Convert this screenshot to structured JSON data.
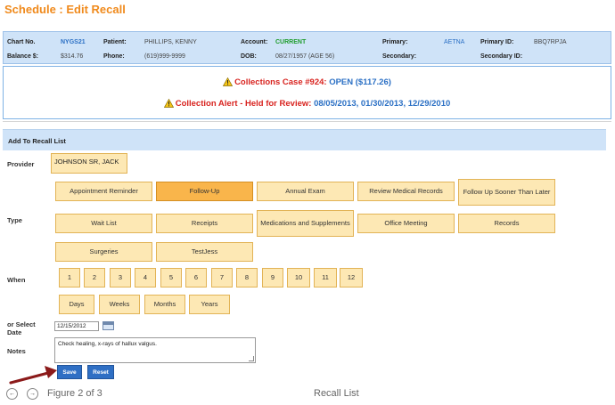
{
  "page_title": "Schedule : Edit Recall",
  "patient": {
    "chart_no_label": "Chart No.",
    "chart_no": "NYGS21",
    "patient_label": "Patient:",
    "patient_name": "PHILLIPS, KENNY",
    "account_label": "Account:",
    "account_status": "CURRENT",
    "primary_label": "Primary:",
    "primary_value": "AETNA",
    "primary_id_label": "Primary ID:",
    "primary_id": "BBQ7RPJA",
    "balance_label": "Balance $:",
    "balance": "$314.76",
    "phone_label": "Phone:",
    "phone": "(619)999-9999",
    "dob_label": "DOB:",
    "dob": "08/27/1957  (AGE 56)",
    "secondary_label": "Secondary:",
    "secondary_id_label": "Secondary ID:"
  },
  "alerts": {
    "case_prefix": "Collections Case #924:",
    "case_status": "OPEN ($117.26)",
    "alert_prefix": "Collection Alert - Held for Review:",
    "alert_dates": "08/05/2013, 01/30/2013, 12/29/2010"
  },
  "section_title": "Add To Recall List",
  "provider": {
    "label": "Provider",
    "value": "JOHNSON SR, JACK"
  },
  "type": {
    "label": "Type",
    "options": [
      "Appointment Reminder",
      "Follow-Up",
      "Annual Exam",
      "Review Medical Records",
      "Follow Up Sooner Than Later",
      "Wait List",
      "Receipts",
      "Medications and Supplements",
      "Office Meeting",
      "Records",
      "Surgeries",
      "TestJess"
    ],
    "selected": "Follow-Up"
  },
  "when": {
    "label": "When",
    "numbers": [
      "1",
      "2",
      "3",
      "4",
      "5",
      "6",
      "7",
      "8",
      "9",
      "10",
      "11",
      "12"
    ],
    "units": [
      "Days",
      "Weeks",
      "Months",
      "Years"
    ]
  },
  "date": {
    "label": "or Select Date",
    "value": "12/15/2012",
    "icon": "calendar-icon"
  },
  "notes": {
    "label": "Notes",
    "value": "Check healing, x-rays of hallux valgus."
  },
  "actions": {
    "save": "Save",
    "reset": "Reset"
  },
  "footer": {
    "figure": "Figure 2 of 3",
    "caption": "Recall List"
  },
  "colors": {
    "title_orange": "#f08a1c",
    "header_blue": "#cfe3f8",
    "option_bg": "#fde8b4",
    "option_selected": "#f9b54b",
    "alert_red": "#d8231f",
    "link_blue": "#2a6fc4",
    "button_blue": "#2f6fc4",
    "arrow_red": "#8b1a1a"
  }
}
